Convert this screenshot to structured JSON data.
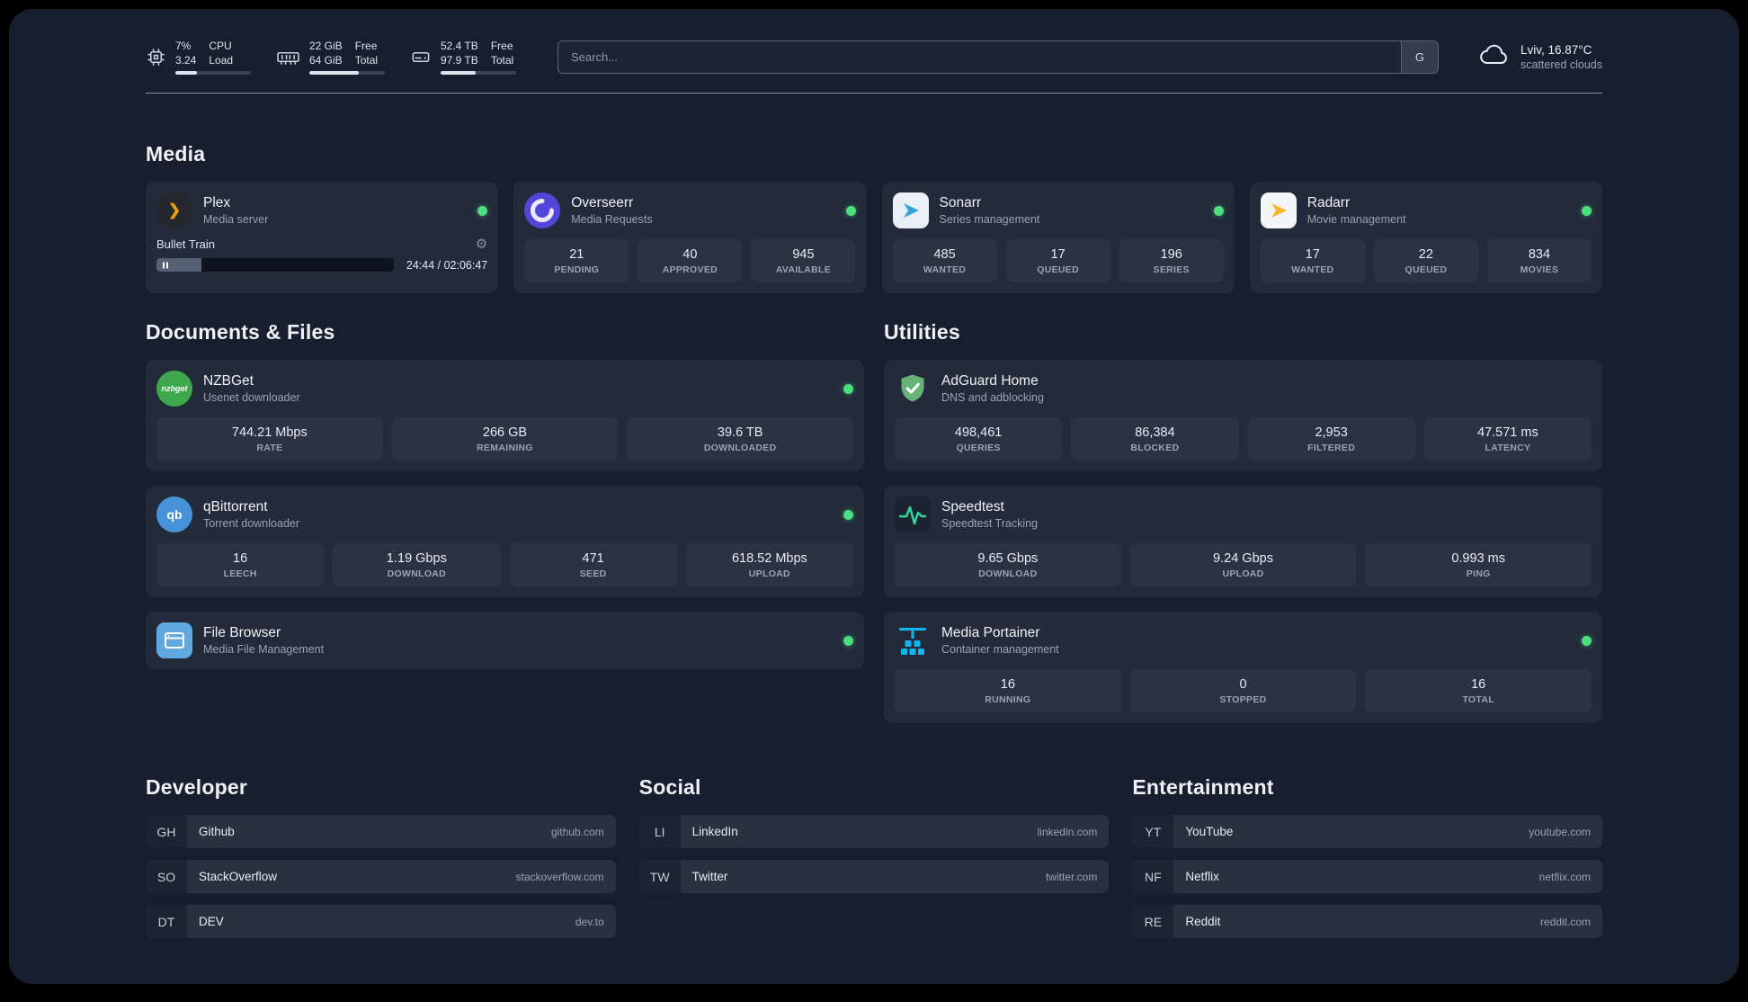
{
  "colors": {
    "status_online": "#4ade80",
    "plex_accent": "#e5a00d",
    "adguard_green": "#67b279",
    "portainer_blue": "#0fb5ee"
  },
  "icons": {
    "gear": "⚙",
    "plex_chevron": "❯",
    "nzbget_label": "nzbget",
    "qbittorrent_label": "qb"
  },
  "topbar": {
    "cpu": {
      "value1": "7%",
      "value2": "3.24",
      "label1": "CPU",
      "label2": "Load",
      "bar_percent": 28
    },
    "memory": {
      "value1": "22 GiB",
      "value2": "64 GiB",
      "label1": "Free",
      "label2": "Total",
      "bar_percent": 66
    },
    "disk": {
      "value1": "52.4 TB",
      "value2": "97.9 TB",
      "label1": "Free",
      "label2": "Total",
      "bar_percent": 47
    },
    "search": {
      "placeholder": "Search...",
      "provider": "G"
    },
    "weather": {
      "location": "Lviv, 16.87°C",
      "condition": "scattered clouds"
    }
  },
  "media": {
    "title": "Media",
    "plex": {
      "name": "Plex",
      "subtitle": "Media server",
      "now_playing": "Bullet Train",
      "time": "24:44 / 02:06:47",
      "progress_percent": 19
    },
    "cards": [
      {
        "name": "Overseerr",
        "subtitle": "Media Requests",
        "stats": [
          {
            "value": "21",
            "label": "PENDING"
          },
          {
            "value": "40",
            "label": "APPROVED"
          },
          {
            "value": "945",
            "label": "AVAILABLE"
          }
        ]
      },
      {
        "name": "Sonarr",
        "subtitle": "Series management",
        "stats": [
          {
            "value": "485",
            "label": "WANTED"
          },
          {
            "value": "17",
            "label": "QUEUED"
          },
          {
            "value": "196",
            "label": "SERIES"
          }
        ]
      },
      {
        "name": "Radarr",
        "subtitle": "Movie management",
        "stats": [
          {
            "value": "17",
            "label": "WANTED"
          },
          {
            "value": "22",
            "label": "QUEUED"
          },
          {
            "value": "834",
            "label": "MOVIES"
          }
        ]
      }
    ]
  },
  "files": {
    "title": "Documents & Files",
    "cards": [
      {
        "name": "NZBGet",
        "subtitle": "Usenet downloader",
        "stats": [
          {
            "value": "744.21 Mbps",
            "label": "RATE"
          },
          {
            "value": "266 GB",
            "label": "REMAINING"
          },
          {
            "value": "39.6 TB",
            "label": "DOWNLOADED"
          }
        ]
      },
      {
        "name": "qBittorrent",
        "subtitle": "Torrent downloader",
        "stats": [
          {
            "value": "16",
            "label": "LEECH"
          },
          {
            "value": "1.19 Gbps",
            "label": "DOWNLOAD"
          },
          {
            "value": "471",
            "label": "SEED"
          },
          {
            "value": "618.52 Mbps",
            "label": "UPLOAD"
          }
        ]
      },
      {
        "name": "File Browser",
        "subtitle": "Media File Management",
        "stats": []
      }
    ]
  },
  "utilities": {
    "title": "Utilities",
    "cards": [
      {
        "name": "AdGuard Home",
        "subtitle": "DNS and adblocking",
        "stats": [
          {
            "value": "498,461",
            "label": "QUERIES"
          },
          {
            "value": "86,384",
            "label": "BLOCKED"
          },
          {
            "value": "2,953",
            "label": "FILTERED"
          },
          {
            "value": "47.571 ms",
            "label": "LATENCY"
          }
        ]
      },
      {
        "name": "Speedtest",
        "subtitle": "Speedtest Tracking",
        "stats": [
          {
            "value": "9.65 Gbps",
            "label": "DOWNLOAD"
          },
          {
            "value": "9.24 Gbps",
            "label": "UPLOAD"
          },
          {
            "value": "0.993 ms",
            "label": "PING"
          }
        ]
      },
      {
        "name": "Media Portainer",
        "subtitle": "Container management",
        "stats": [
          {
            "value": "16",
            "label": "RUNNING"
          },
          {
            "value": "0",
            "label": "STOPPED"
          },
          {
            "value": "16",
            "label": "TOTAL"
          }
        ]
      }
    ]
  },
  "bookmarks": {
    "groups": [
      {
        "title": "Developer",
        "links": [
          {
            "abbr": "GH",
            "name": "Github",
            "domain": "github.com"
          },
          {
            "abbr": "SO",
            "name": "StackOverflow",
            "domain": "stackoverflow.com"
          },
          {
            "abbr": "DT",
            "name": "DEV",
            "domain": "dev.to"
          }
        ]
      },
      {
        "title": "Social",
        "links": [
          {
            "abbr": "LI",
            "name": "LinkedIn",
            "domain": "linkedin.com"
          },
          {
            "abbr": "TW",
            "name": "Twitter",
            "domain": "twitter.com"
          }
        ]
      },
      {
        "title": "Entertainment",
        "links": [
          {
            "abbr": "YT",
            "name": "YouTube",
            "domain": "youtube.com"
          },
          {
            "abbr": "NF",
            "name": "Netflix",
            "domain": "netflix.com"
          },
          {
            "abbr": "RE",
            "name": "Reddit",
            "domain": "reddit.com"
          }
        ]
      }
    ]
  }
}
